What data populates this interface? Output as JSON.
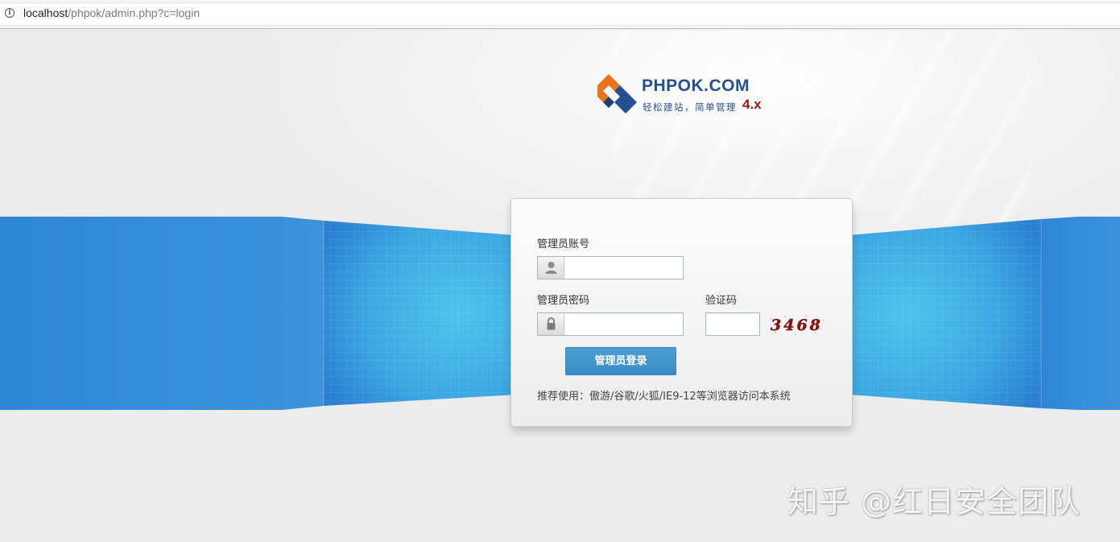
{
  "browser": {
    "url_host": "localhost",
    "url_path": "/phpok/admin.php?c=login",
    "info_icon": "info-icon"
  },
  "logo": {
    "name": "PHPOK.COM",
    "slogan": "轻松建站，简单管理",
    "version": "4.x"
  },
  "login": {
    "account_label": "管理员账号",
    "account_value": "",
    "account_icon": "user-icon",
    "password_label": "管理员密码",
    "password_value": "",
    "password_icon": "lock-icon",
    "captcha_label": "验证码",
    "captcha_value": "",
    "captcha_code": "3468",
    "submit_label": "管理员登录",
    "recommend_text": "推荐使用：傲游/谷歌/火狐/IE9-12等浏览器访问本系统"
  },
  "watermark": "知乎 @红日安全团队",
  "colors": {
    "band_blue": "#3a8fd8",
    "button_blue": "#4b9ed4",
    "logo_blue": "#24508f",
    "logo_orange": "#e8741f",
    "version_red": "#a0141b",
    "captcha_red": "#8b1010"
  }
}
